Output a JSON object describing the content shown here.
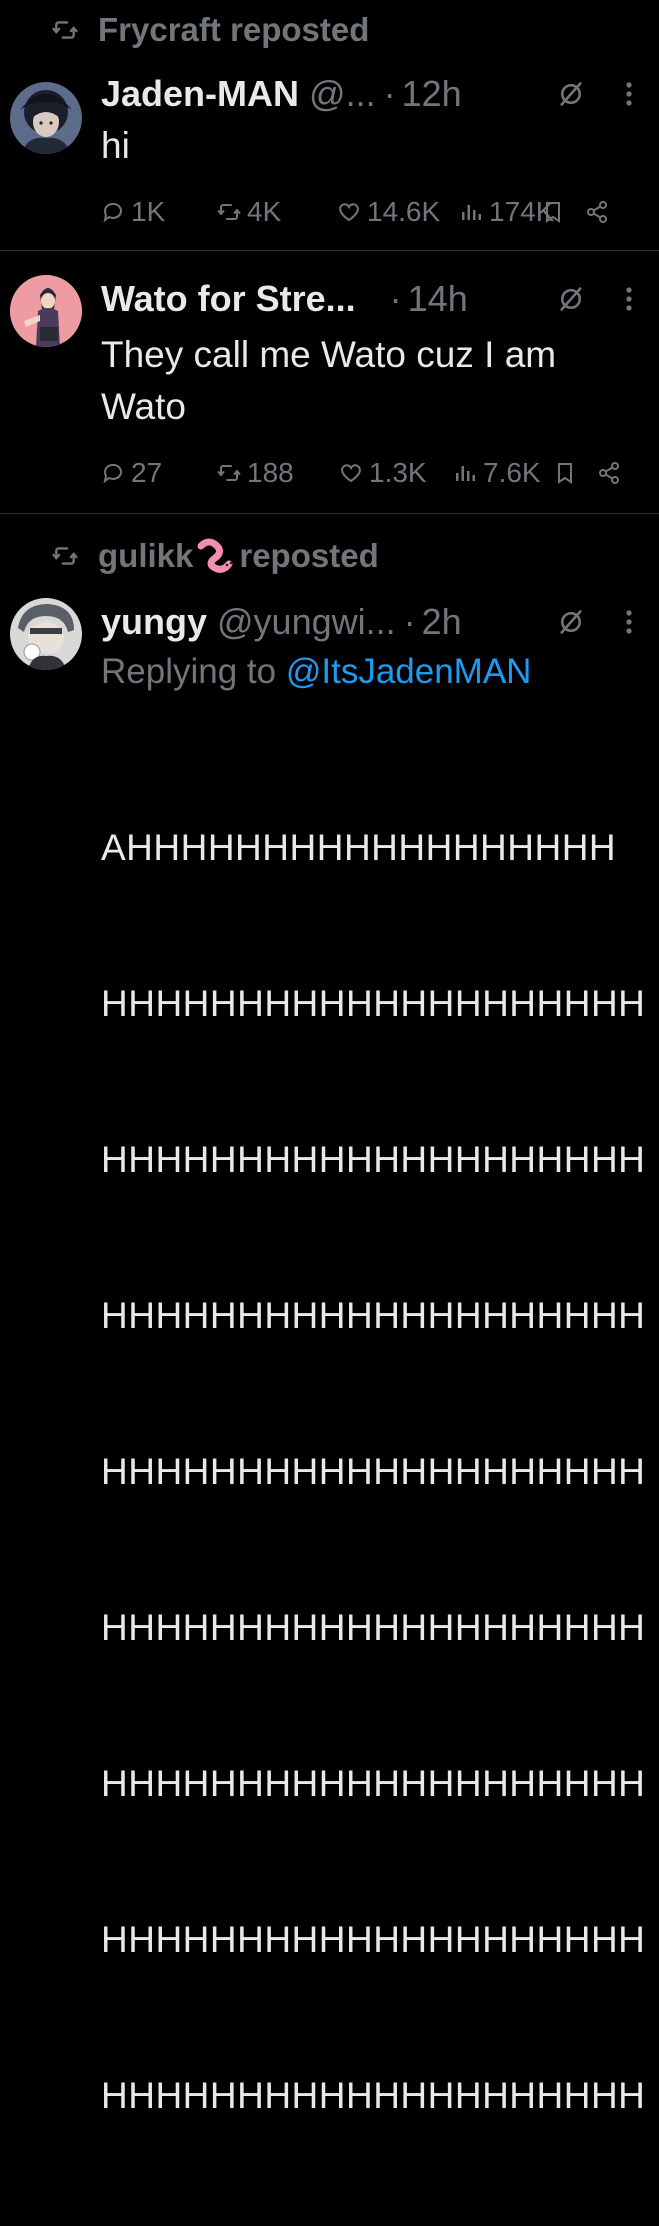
{
  "tweets": [
    {
      "reposted_by": "Frycraft reposted",
      "name": "Jaden-MAN",
      "handle": "@...",
      "separator": "·",
      "time": "12h",
      "text": "hi",
      "stats": {
        "replies": "1K",
        "reposts": "4K",
        "likes": "14.6K",
        "views": "174K"
      }
    },
    {
      "name": "Wato for Stre...",
      "separator": "·",
      "time": "14h",
      "text_lines": [
        "They call me Wato cuz I am",
        "Wato"
      ],
      "stats": {
        "replies": "27",
        "reposts": "188",
        "likes": "1.3K",
        "views": "7.6K"
      }
    },
    {
      "reposted_by_name": "gulikk",
      "reposted_suffix": "reposted",
      "name": "yungy",
      "handle": "@yungwi...",
      "separator": "·",
      "time": "2h",
      "replying_prefix": "Replying to",
      "replying_mention": "@ItsJadenMAN",
      "text_lines": [
        "AHHHHHHHHHHHHHHHHHH",
        "HHHHHHHHHHHHHHHHHHHH",
        "HHHHHHHHHHHHHHHHHHHH",
        "HHHHHHHHHHHHHHHHHHHH",
        "HHHHHHHHHHHHHHHHHHHH",
        "HHHHHHHHHHHHHHHHHHHH",
        "HHHHHHHHHHHHHHHHHHHH",
        "HHHHHHHHHHHHHHHHHHHH",
        "HHHHHHHHHHHHHHHHHHHH"
      ]
    }
  ],
  "colors": {
    "background": "#000000",
    "text_primary": "#e7e9ea",
    "text_secondary": "#71767b",
    "link": "#1d9bf0",
    "divider": "#2f3336"
  },
  "icons": [
    "repost-icon",
    "reply-icon",
    "like-icon",
    "views-icon",
    "bookmark-icon",
    "share-icon",
    "grok-icon",
    "more-icon",
    "worm-emoji"
  ]
}
